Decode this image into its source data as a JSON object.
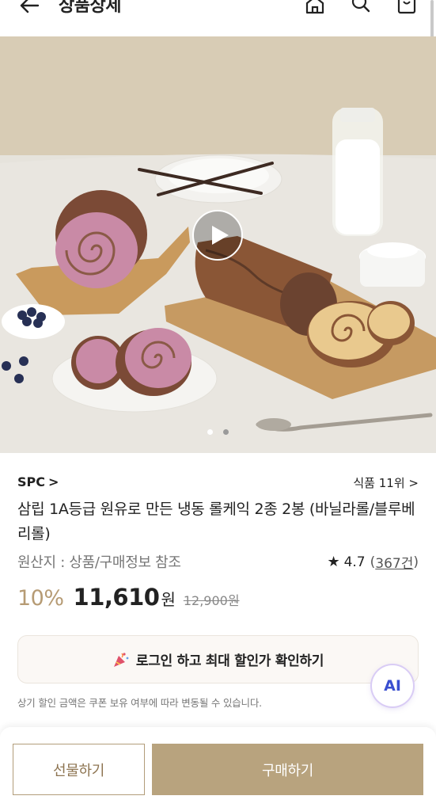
{
  "header": {
    "title": "상품상세",
    "back_icon": "arrow-left-icon",
    "icons": [
      "home-icon",
      "search-icon",
      "cart-icon"
    ]
  },
  "hero": {
    "play_icon": "play-icon",
    "dots": 2,
    "active_dot": 0
  },
  "product": {
    "brand": "SPC",
    "brand_chevron": ">",
    "rank": "식품 11위",
    "rank_chevron": ">",
    "name": "삼립 1A등급 원유로 만든 냉동 롤케익 2종 2봉 (바닐라롤/블루베리롤)",
    "origin": "원산지 : 상품/구매정보 참조",
    "rating": "4.7",
    "review_open": "(",
    "review_count": "367건",
    "review_close": ")",
    "discount": "10%",
    "price": "11,610",
    "currency": "원",
    "original_price": "12,900원"
  },
  "login_banner": {
    "icon": "party-popper-icon",
    "text": "로그인 하고 최대 할인가 확인하기"
  },
  "ai_button": {
    "label": "AI"
  },
  "notice": "상기 할인 금액은 쿠폰 보유 여부에 따라 변동될 수 있습니다.",
  "bottom_bar": {
    "gift_label": "선물하기",
    "buy_label": "구매하기"
  },
  "colors": {
    "accent": "#b8a37e",
    "discount": "#b69b74",
    "ai": "#3a4fd0"
  }
}
